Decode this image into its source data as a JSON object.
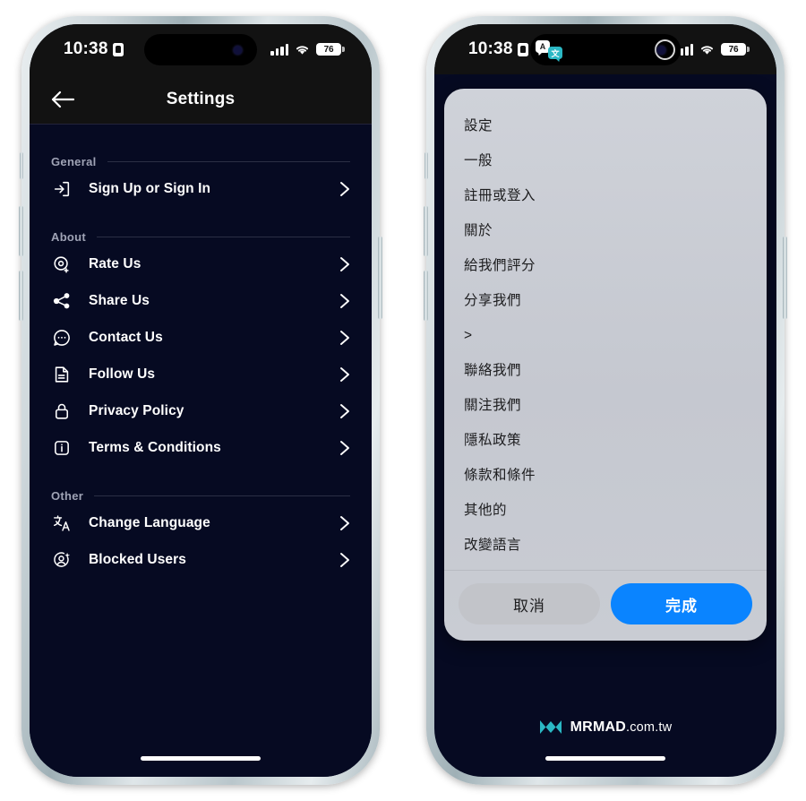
{
  "status_bar": {
    "time": "10:38",
    "battery_percent": "76",
    "signal_icon": "cellular-bars-icon",
    "wifi_icon": "wifi-icon",
    "time_badge_icon": "id-badge-icon",
    "battery_icon": "battery-icon"
  },
  "dynamic_island": {
    "translate_badge_a": "A",
    "translate_badge_cjk": "文",
    "translate_icon_name": "translate-live-activity-icon",
    "ring_icon_name": "recording-ring-icon"
  },
  "nav": {
    "back_icon": "back-arrow-icon",
    "title": "Settings"
  },
  "settings": {
    "sections": [
      {
        "label": "General",
        "rows": [
          {
            "icon": "sign-in-icon",
            "label": "Sign Up or Sign In"
          }
        ]
      },
      {
        "label": "About",
        "rows": [
          {
            "icon": "rate-us-icon",
            "label": "Rate Us"
          },
          {
            "icon": "share-icon",
            "label": "Share Us"
          },
          {
            "icon": "chat-bubble-icon",
            "label": "Contact Us"
          },
          {
            "icon": "document-icon",
            "label": "Follow Us"
          },
          {
            "icon": "lock-icon",
            "label": "Privacy Policy"
          },
          {
            "icon": "info-icon",
            "label": "Terms & Conditions"
          }
        ]
      },
      {
        "label": "Other",
        "rows": [
          {
            "icon": "translate-icon",
            "label": "Change Language"
          },
          {
            "icon": "blocked-user-icon",
            "label": "Blocked Users"
          }
        ]
      }
    ],
    "chevron_icon": "chevron-right-icon"
  },
  "translate_overlay": {
    "lines": [
      "設定",
      "一般",
      "註冊或登入",
      "關於",
      "給我們評分",
      "分享我們",
      ">",
      "聯絡我們",
      "關注我們",
      "隱私政策",
      "條款和條件",
      "其他的",
      "改變語言"
    ],
    "cancel_label": "取消",
    "done_label": "完成"
  },
  "watermark": {
    "logo_icon": "mrmad-logo-icon",
    "brand": "MRMAD",
    "domain": ".com.tw"
  },
  "colors": {
    "screen_background": "#060a22",
    "bar_background": "#121212",
    "accent_blue": "#0a84ff",
    "overlay_background": "#c9ccd3",
    "section_label": "#9fa3b5",
    "logo_teal": "#2bb8c4"
  }
}
